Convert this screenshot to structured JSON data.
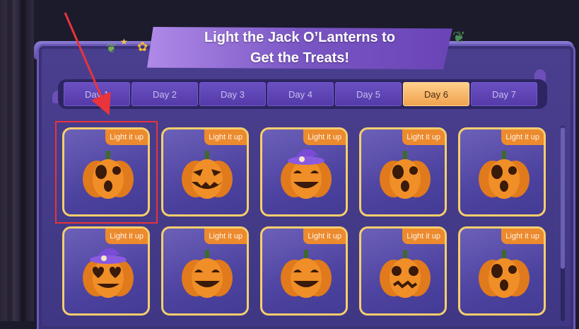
{
  "banner": {
    "title_line1": "Light the Jack O’Lanterns to",
    "title_line2": "Get the Treats!"
  },
  "tabs": [
    {
      "label": "Day 1",
      "active": false
    },
    {
      "label": "Day 2",
      "active": false
    },
    {
      "label": "Day 3",
      "active": false
    },
    {
      "label": "Day 4",
      "active": false
    },
    {
      "label": "Day 5",
      "active": false
    },
    {
      "label": "Day 6",
      "active": true
    },
    {
      "label": "Day 7",
      "active": false
    }
  ],
  "cards": [
    {
      "badge": "Light it up",
      "face": "surprised",
      "hat": false
    },
    {
      "badge": "Light it up",
      "face": "grin",
      "hat": false
    },
    {
      "badge": "Light it up",
      "face": "happy",
      "hat": true
    },
    {
      "badge": "Light it up",
      "face": "surprised",
      "hat": false
    },
    {
      "badge": "Light it up",
      "face": "surprised",
      "hat": false
    },
    {
      "badge": "Light it up",
      "face": "heart",
      "hat": true
    },
    {
      "badge": "Light it up",
      "face": "happy",
      "hat": false
    },
    {
      "badge": "Light it up",
      "face": "happy",
      "hat": false
    },
    {
      "badge": "Light it up",
      "face": "scared",
      "hat": false
    },
    {
      "badge": "Light it up",
      "face": "surprised",
      "hat": false
    }
  ],
  "colors": {
    "highlight": "#e8343a",
    "active_tab": "#f0a34e",
    "card_border": "#f6cf6c",
    "badge": "#ec8a2e"
  }
}
